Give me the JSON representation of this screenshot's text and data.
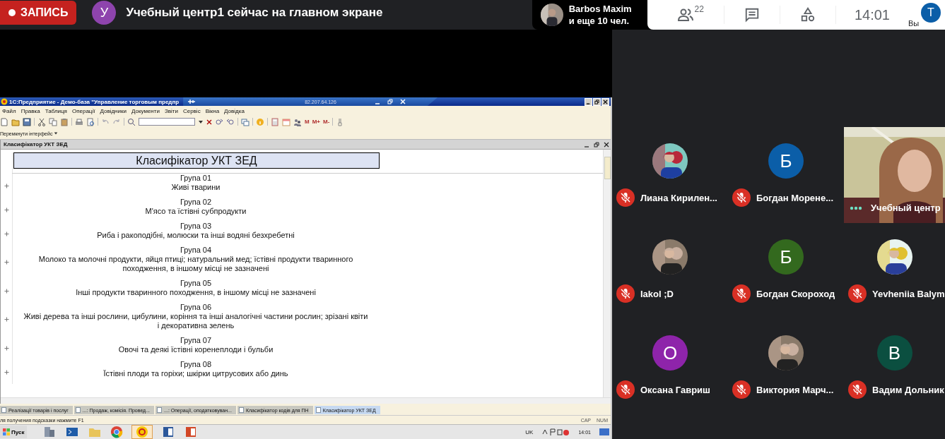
{
  "meet_bar": {
    "record_label": "ЗАПИСЬ",
    "presenter": {
      "initial": "У",
      "color": "#8e44ad",
      "text": "Учебный центр1 сейчас на главном экране"
    },
    "others": {
      "name": "Barbos Maxim",
      "more": "и еще 10 чел."
    },
    "people_count": "22",
    "time": "14:01",
    "self": {
      "initial": "T",
      "label": "Вы"
    }
  },
  "shared_screen": {
    "window_title": "1С:Предприятие - Демо-база \"Управление торговым предпр",
    "remote_address": "82.207.64.126",
    "menu": [
      "Файл",
      "Правка",
      "Таблиця",
      "Операції",
      "Довідники",
      "Документи",
      "Звіти",
      "Сервіс",
      "Вікна",
      "Довідка"
    ],
    "memory_buttons": [
      "M",
      "M+",
      "M-"
    ],
    "interface_switch": "Перемкнути інтерфейс",
    "document": {
      "window_title": "Класифікатор УКТ ЗЕД",
      "heading": "Класифікатор УКТ ЗЕД",
      "groups": [
        {
          "code": "Група 01",
          "name": "Живі тварини"
        },
        {
          "code": "Група 02",
          "name": "М'ясо та їстівні субпродукти"
        },
        {
          "code": "Група 03",
          "name": "Риба і ракоподібні, молюски та інші водяні безхребетні"
        },
        {
          "code": "Група 04",
          "name": "Молоко та молочні продукти, яйця птиці; натуральний мед; їстівні продукти тваринного походження, в іншому місці не зазначені"
        },
        {
          "code": "Група 05",
          "name": "Інші продукти тваринного походження, в іншому місці не зазначені"
        },
        {
          "code": "Група 06",
          "name": "Живі дерева та інші рослини, цибулини, коріння та інші аналогічні частини рослин; зрізані квіти і декоративна зелень"
        },
        {
          "code": "Група 07",
          "name": "Овочі та деякі їстівні коренеплоди і бульби"
        },
        {
          "code": "Група 08",
          "name": "Їстівні плоди та горіхи; шкірки цитрусових або динь"
        }
      ]
    },
    "window_tabs": [
      {
        "label": "Реалізації товарів і послуг",
        "selected": false
      },
      {
        "label": "...: Продаж, комісія. Провед...",
        "selected": false
      },
      {
        "label": "...: Операції, оподатковуван...",
        "selected": false
      },
      {
        "label": "Класифікатор кодів для ПН",
        "selected": false
      },
      {
        "label": "Класифікатор УКТ ЗЕД",
        "selected": true
      }
    ],
    "status_hint": "ля получения подсказки нажмите F1",
    "indicators": [
      "CAP",
      "NUM"
    ],
    "taskbar": {
      "start": "Пуск",
      "language": "UK",
      "clock": "14:01"
    }
  },
  "participants": [
    {
      "name": "Лиана Кирилен...",
      "muted": true
    },
    {
      "kind": "letter",
      "initial": "Б",
      "color": "#0b5ea8",
      "name": "Богдан Морене...",
      "muted": true
    },
    {
      "kind": "video",
      "name": "Учебный центр",
      "muted": false
    },
    {
      "name": "Iakol ;D",
      "muted": true
    },
    {
      "kind": "letter",
      "initial": "Б",
      "color": "#33691e",
      "name": "Богдан Скороход",
      "muted": true
    },
    {
      "name": "Yevheniia Balym",
      "muted": true
    },
    {
      "kind": "letter",
      "initial": "О",
      "color": "#8e24aa",
      "name": "Оксана Гавриш",
      "muted": true
    },
    {
      "name": "Виктория Марч...",
      "muted": true
    },
    {
      "kind": "letter",
      "initial": "В",
      "color": "#0b4f40",
      "name": "Вадим Дольник",
      "muted": true
    }
  ]
}
